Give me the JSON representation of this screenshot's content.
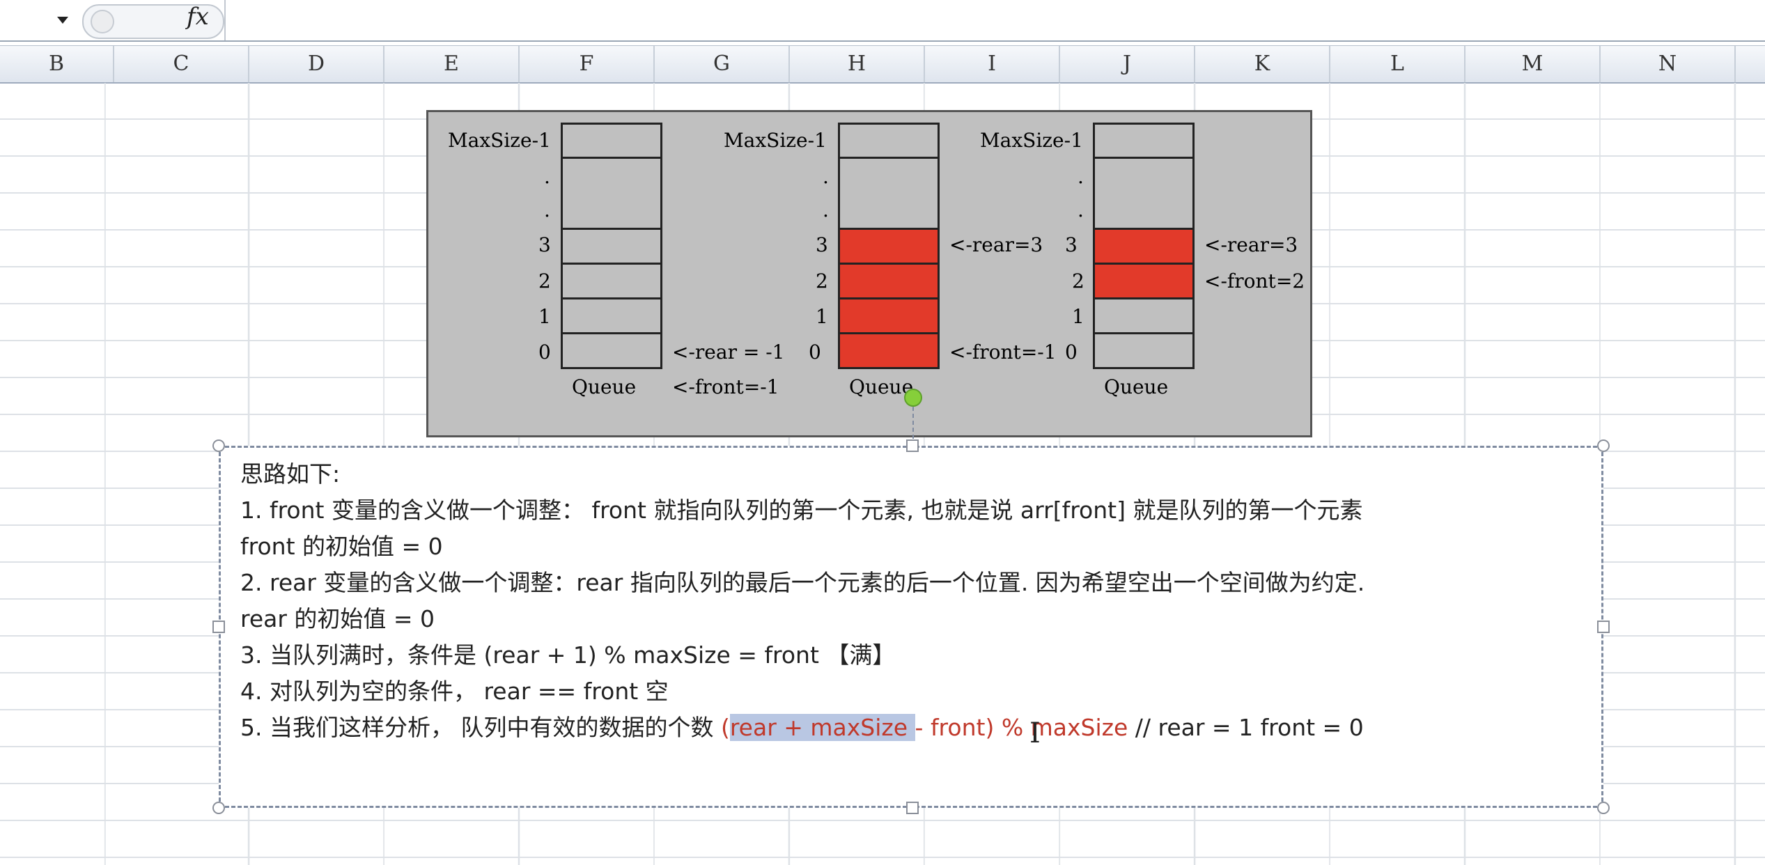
{
  "formula_bar": {
    "fx_label": "fx",
    "formula_value": ""
  },
  "columns": [
    "B",
    "C",
    "D",
    "E",
    "F",
    "G",
    "H",
    "I",
    "J",
    "K",
    "L",
    "M",
    "N"
  ],
  "diagram": {
    "queues": [
      {
        "maxsize_label": "MaxSize-1",
        "dot1": ".",
        "dot2": ".",
        "idx3": "3",
        "idx2": "2",
        "idx1": "1",
        "idx0": "0",
        "caption": "Queue",
        "filled_slots": []
      },
      {
        "maxsize_label": "MaxSize-1",
        "dot1": ".",
        "dot2": ".",
        "idx3": "3",
        "idx2": "2",
        "idx1": "1",
        "idx0": "0",
        "caption": "Queue",
        "filled_slots": [
          0,
          1,
          2,
          3
        ]
      },
      {
        "maxsize_label": "MaxSize-1",
        "dot1": ".",
        "dot2": ".",
        "idx3": "3",
        "idx2": "2",
        "idx1": "1",
        "idx0": "0",
        "caption": "Queue",
        "filled_slots": [
          2,
          3
        ]
      }
    ],
    "pointers": {
      "q1_rear": "<-rear = -1",
      "q1_front": "<-front=-1",
      "q2_rear": "<-rear=3",
      "q2_front": "<-front=-1",
      "q3_rear": "<-rear=3",
      "q3_front": "<-front=2"
    }
  },
  "textbox": {
    "line0": "思路如下:",
    "line1": "1.  front 变量的含义做一个调整：  front 就指向队列的第一个元素, 也就是说 arr[front] 就是队列的第一个元素",
    "line2": "front 的初始值 = 0",
    "line3": "2.  rear 变量的含义做一个调整：rear 指向队列的最后一个元素的后一个位置. 因为希望空出一个空间做为约定.",
    "line4": "rear 的初始值 = 0",
    "line5": "3. 当队列满时，条件是  (rear  + 1)  % maxSize = front 【满】",
    "line6": "4. 对队列为空的条件，  rear == front 空",
    "line7_prefix": "5. 当我们这样分析，  队列中有效的数据的个数  ",
    "line7_red_a": "(",
    "line7_highlight": "rear + maxSize ",
    "line7_red_b": "- front) % maxSize",
    "line7_suffix": "   // rear = 1 front = 0"
  },
  "cursor_glyph": "I"
}
